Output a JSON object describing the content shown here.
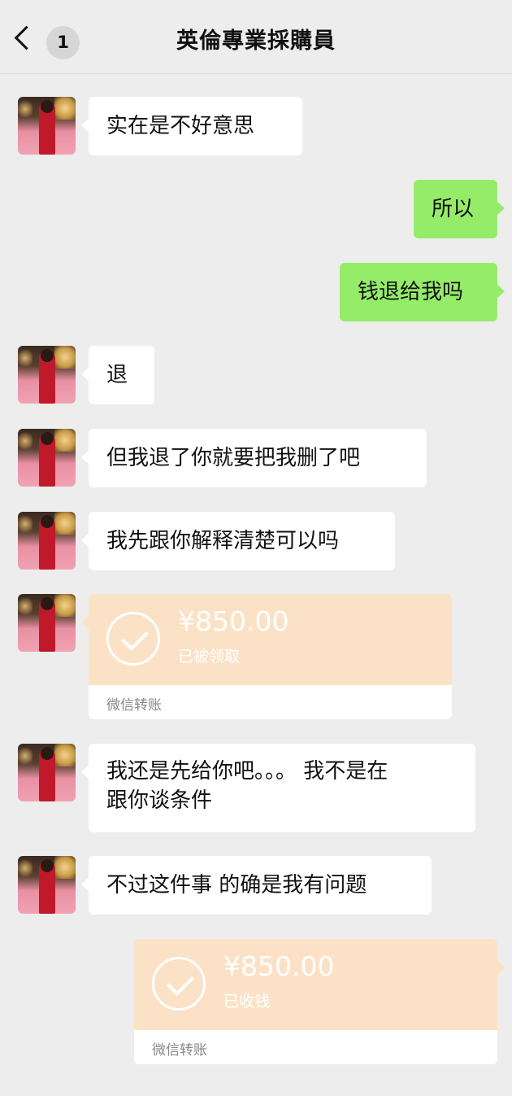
{
  "header": {
    "back_badge": "1",
    "title": "英倫專業採購員"
  },
  "messages": {
    "m1": "实在是不好意思",
    "m2": "所以",
    "m3": "钱退给我吗",
    "m4": "退",
    "m5": "但我退了你就要把我删了吧",
    "m6": "我先跟你解释清楚可以吗",
    "t1": {
      "amount": "¥850.00",
      "status": "已被领取",
      "footer": "微信转账"
    },
    "m7_line1": "我还是先给你吧。。。 我不是在",
    "m7_line2": "跟你谈条件",
    "m8": "不过这件事 的确是我有问题",
    "t2": {
      "amount": "¥850.00",
      "status": "已收钱",
      "footer": "微信转账"
    }
  },
  "colors": {
    "sent_bubble": "#95ec69",
    "received_bubble": "#ffffff",
    "transfer": "#fbe2c6",
    "background": "#ededed"
  },
  "icons": {
    "back": "chevron-left-icon",
    "transfer": "check-circle-icon",
    "avatar": "photo-avatar"
  }
}
